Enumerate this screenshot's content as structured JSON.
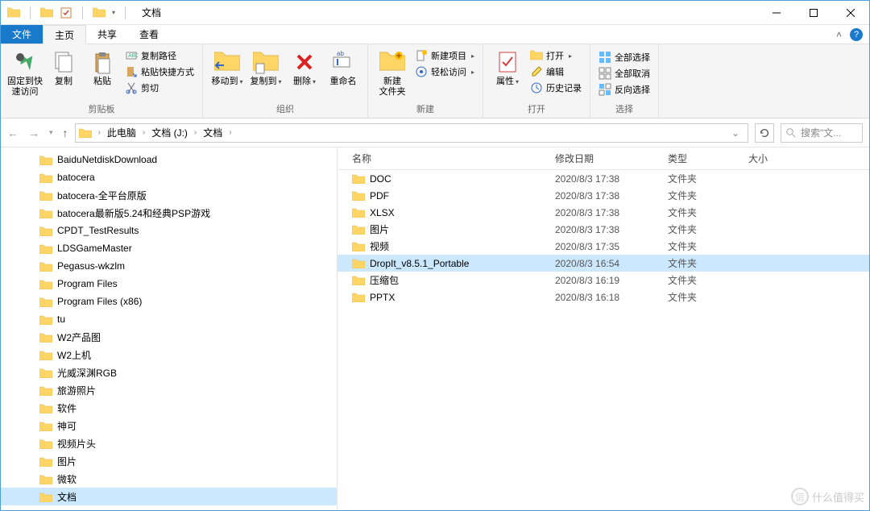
{
  "window": {
    "title": "文档"
  },
  "tabs": {
    "file": "文件",
    "home": "主页",
    "share": "共享",
    "view": "查看"
  },
  "ribbon": {
    "clipboard": {
      "pin": "固定到快\n速访问",
      "copy": "复制",
      "paste": "粘贴",
      "copy_path": "复制路径",
      "paste_shortcut": "粘贴快捷方式",
      "cut": "剪切",
      "label": "剪贴板"
    },
    "organize": {
      "move_to": "移动到",
      "copy_to": "复制到",
      "delete": "删除",
      "rename": "重命名",
      "label": "组织"
    },
    "new": {
      "new_folder": "新建\n文件夹",
      "new_item": "新建项目",
      "easy_access": "轻松访问",
      "label": "新建"
    },
    "open": {
      "properties": "属性",
      "open": "打开",
      "edit": "编辑",
      "history": "历史记录",
      "label": "打开"
    },
    "select": {
      "select_all": "全部选择",
      "select_none": "全部取消",
      "invert": "反向选择",
      "label": "选择"
    }
  },
  "nav": {
    "crumbs": [
      "此电脑",
      "文档 (J:)",
      "文档"
    ],
    "search_placeholder": "搜索\"文..."
  },
  "tree": [
    "BaiduNetdiskDownload",
    "batocera",
    "batocera-全平台原版",
    "batocera最新版5.24和经典PSP游戏",
    "CPDT_TestResults",
    "LDSGameMaster",
    "Pegasus-wkzlm",
    "Program Files",
    "Program Files (x86)",
    "tu",
    "W2产品图",
    "W2上机",
    "光威深渊RGB",
    "旅游照片",
    "软件",
    "神可",
    "视频片头",
    "图片",
    "微软",
    "文档"
  ],
  "tree_selected": 19,
  "columns": {
    "name": "名称",
    "date": "修改日期",
    "type": "类型",
    "size": "大小"
  },
  "rows": [
    {
      "name": "DOC",
      "date": "2020/8/3 17:38",
      "type": "文件夹"
    },
    {
      "name": "PDF",
      "date": "2020/8/3 17:38",
      "type": "文件夹"
    },
    {
      "name": "XLSX",
      "date": "2020/8/3 17:38",
      "type": "文件夹"
    },
    {
      "name": "图片",
      "date": "2020/8/3 17:38",
      "type": "文件夹"
    },
    {
      "name": "视频",
      "date": "2020/8/3 17:35",
      "type": "文件夹"
    },
    {
      "name": "DropIt_v8.5.1_Portable",
      "date": "2020/8/3 16:54",
      "type": "文件夹",
      "selected": true
    },
    {
      "name": "压缩包",
      "date": "2020/8/3 16:19",
      "type": "文件夹"
    },
    {
      "name": "PPTX",
      "date": "2020/8/3 16:18",
      "type": "文件夹"
    }
  ],
  "watermark": "什么值得买"
}
